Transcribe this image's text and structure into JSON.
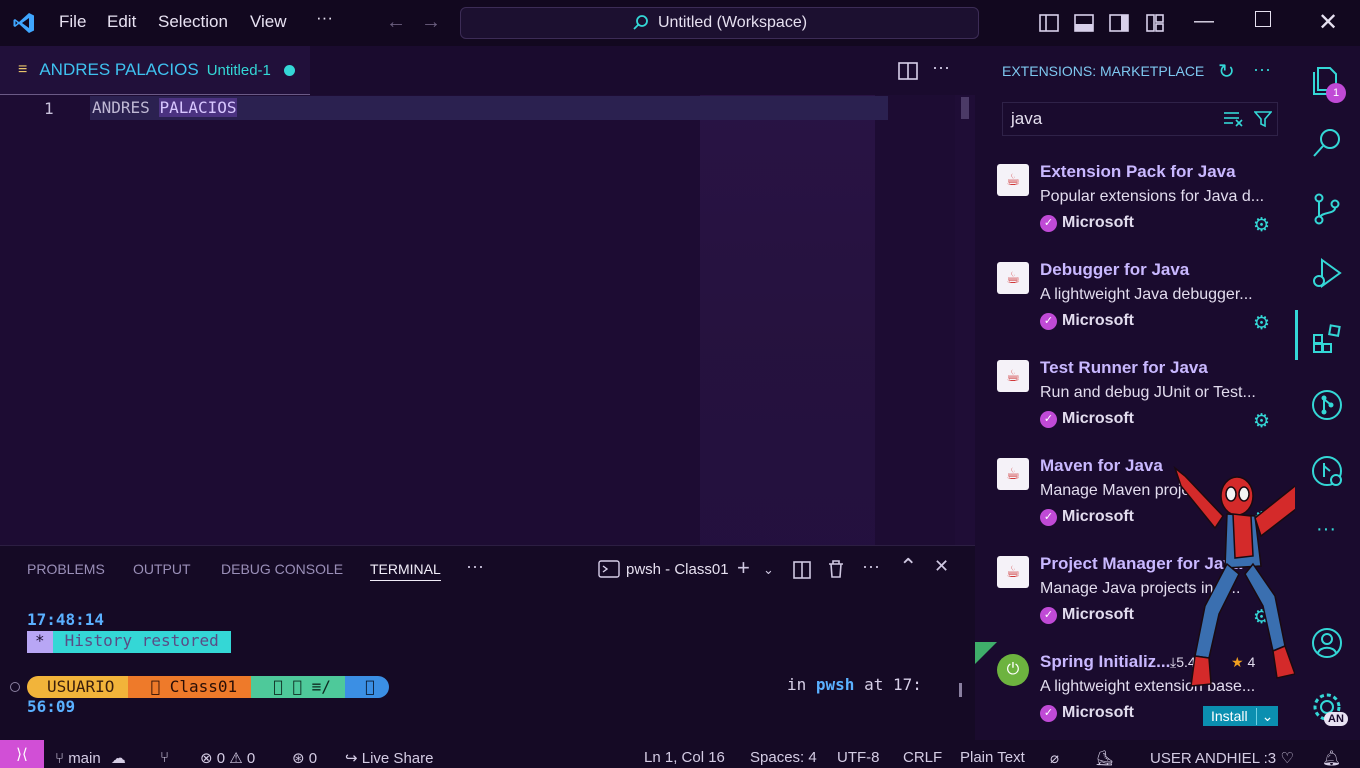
{
  "titlebar": {
    "menu": [
      "File",
      "Edit",
      "Selection",
      "View",
      "···"
    ],
    "command_center": "Untitled (Workspace)"
  },
  "editor": {
    "tab_title": "ANDRES PALACIOS",
    "tab_subtitle": "Untitled-1",
    "line_number": "1",
    "line_text_a": "ANDRES",
    "line_text_b": "PALACIOS"
  },
  "panel": {
    "tabs": [
      "PROBLEMS",
      "OUTPUT",
      "DEBUG CONSOLE",
      "TERMINAL",
      "···"
    ],
    "terminal_name": "pwsh - Class01",
    "time": "17:48:14",
    "history_star": "*",
    "history_msg": "History restored",
    "prompt_user": "USUARIO",
    "prompt_dir": " Class01",
    "prompt_git": "  ≡/",
    "prompt_end": "",
    "right_in": "in",
    "right_shell": "pwsh",
    "right_at": "at 17:",
    "line2": "56:09"
  },
  "sidebar": {
    "title": "EXTENSIONS: MARKETPLACE",
    "search_value": "java",
    "extensions": [
      {
        "name": "Extension Pack for Java",
        "desc": "Popular extensions for Java d...",
        "publisher": "Microsoft"
      },
      {
        "name": "Debugger for Java",
        "desc": "A lightweight Java debugger...",
        "publisher": "Microsoft"
      },
      {
        "name": "Test Runner for Java",
        "desc": "Run and debug JUnit or Test...",
        "publisher": "Microsoft"
      },
      {
        "name": "Maven for Java",
        "desc": "Manage Maven proje...",
        "publisher": "Microsoft"
      },
      {
        "name": "Project Manager for Java",
        "desc": "Manage Java projects in V...",
        "publisher": "Microsoft"
      },
      {
        "name": "Spring Initializ...",
        "desc": "A lightweight extension base...",
        "publisher": "Microsoft",
        "downloads": "5.4M",
        "rating": "4",
        "install": "Install"
      }
    ]
  },
  "activity": {
    "explorer_badge": "1",
    "account_badge": "AN"
  },
  "statusbar": {
    "branch": "main",
    "errors": "0",
    "warnings": "0",
    "ports": "0",
    "live_share": "Live Share",
    "position": "Ln 1, Col 16",
    "spaces": "Spaces: 4",
    "encoding": "UTF-8",
    "eol": "CRLF",
    "language": "Plain Text",
    "user": "USER ANDHIEL :3"
  },
  "colors": {
    "accent": "#34d7d6",
    "purple": "#c9b8ff",
    "badge": "#c04ad6"
  }
}
